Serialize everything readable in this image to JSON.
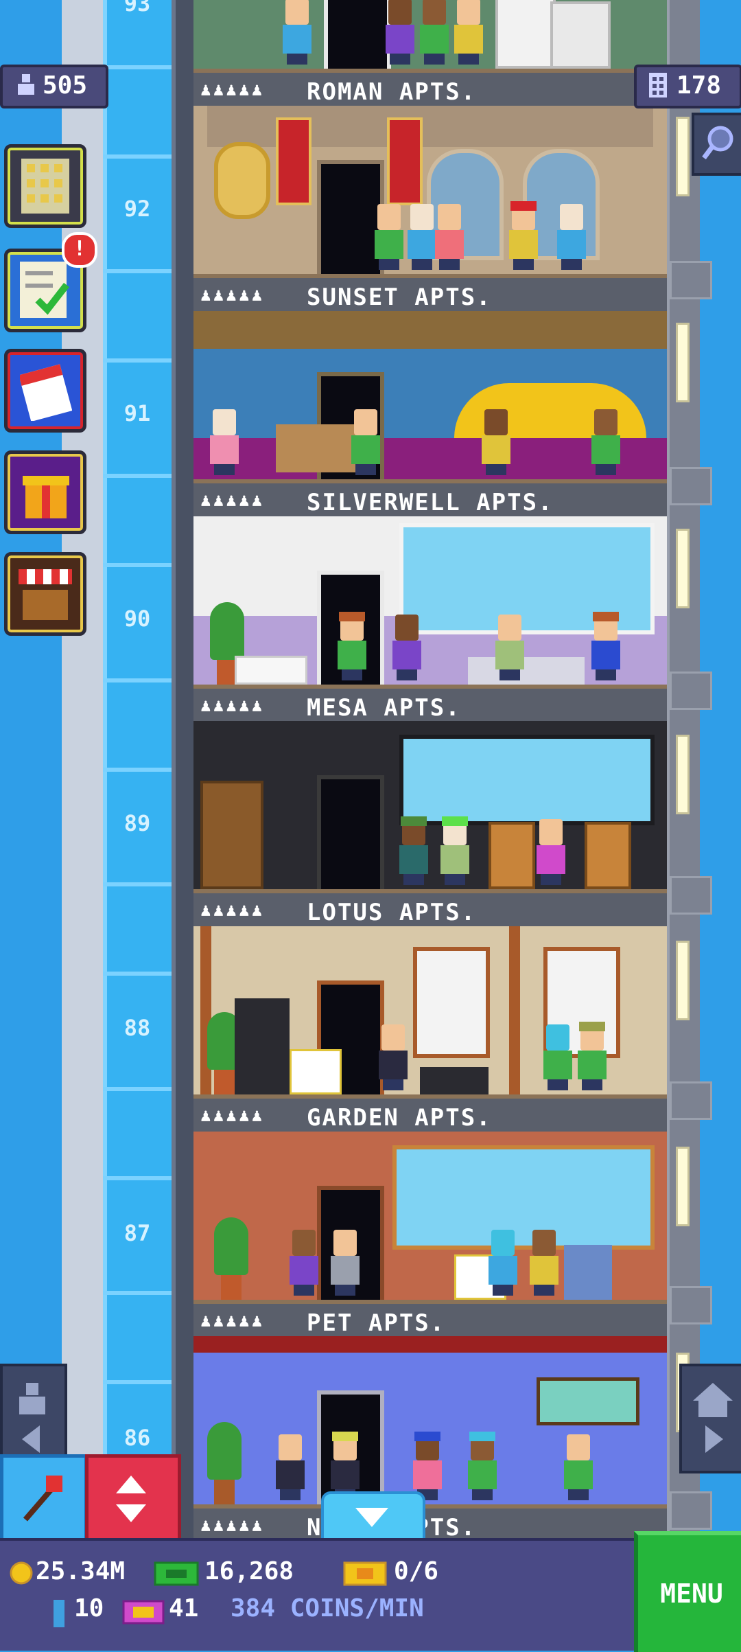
{
  "hud": {
    "population": "505",
    "floors": "178"
  },
  "side_buttons": {
    "quests_badge": "!"
  },
  "elevator": {
    "floor_labels": [
      "93",
      "92",
      "91",
      "90",
      "89",
      "88",
      "87",
      "86"
    ]
  },
  "floors": [
    {
      "name": "ROMAN APTS.",
      "people": "♟♟♟♟♟"
    },
    {
      "name": "SUNSET APTS.",
      "people": "♟♟♟♟♟"
    },
    {
      "name": "SILVERWELL APTS.",
      "people": "♟♟♟♟♟"
    },
    {
      "name": "MESA APTS.",
      "people": "♟♟♟♟♟"
    },
    {
      "name": "LOTUS APTS.",
      "people": "♟♟♟♟♟"
    },
    {
      "name": "GARDEN APTS.",
      "people": "♟♟♟♟♟"
    },
    {
      "name": "PET APTS.",
      "people": "♟♟♟♟♟"
    },
    {
      "name": "N           ING APTS.",
      "people": "♟♟♟♟♟"
    }
  ],
  "bottom": {
    "coins": "25.34M",
    "bux": "16,268",
    "tickets": "0/6",
    "keys": "10",
    "vip": "41",
    "rate": "384 COINS/MIN",
    "menu": "MENU"
  },
  "colors": {
    "sky": "#2f9ee8",
    "shaft": "#36b2f2",
    "menu_green": "#25b63b",
    "elevator_red": "#e3334d",
    "bar": "#4a4a86"
  }
}
